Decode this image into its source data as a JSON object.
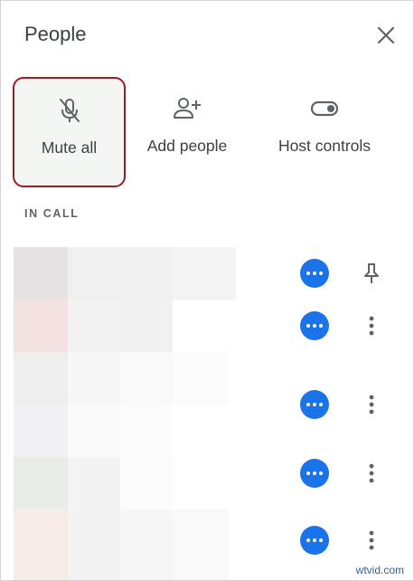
{
  "header": {
    "title": "People"
  },
  "icons": {
    "close": "close-icon",
    "mute": "mic-off-icon",
    "add": "person-add-icon",
    "host": "toggle-icon",
    "more": "more-horizontal-icon",
    "pin": "pin-icon",
    "kebab": "more-vert-icon"
  },
  "actions": [
    {
      "label": "Mute all"
    },
    {
      "label": "Add people"
    },
    {
      "label": "Host controls"
    }
  ],
  "section_label": "IN CALL",
  "participants_shown": 5,
  "colors": {
    "accent": "#1a73e8",
    "highlight_border": "#9e1b22"
  },
  "watermark": "wtvid.com"
}
